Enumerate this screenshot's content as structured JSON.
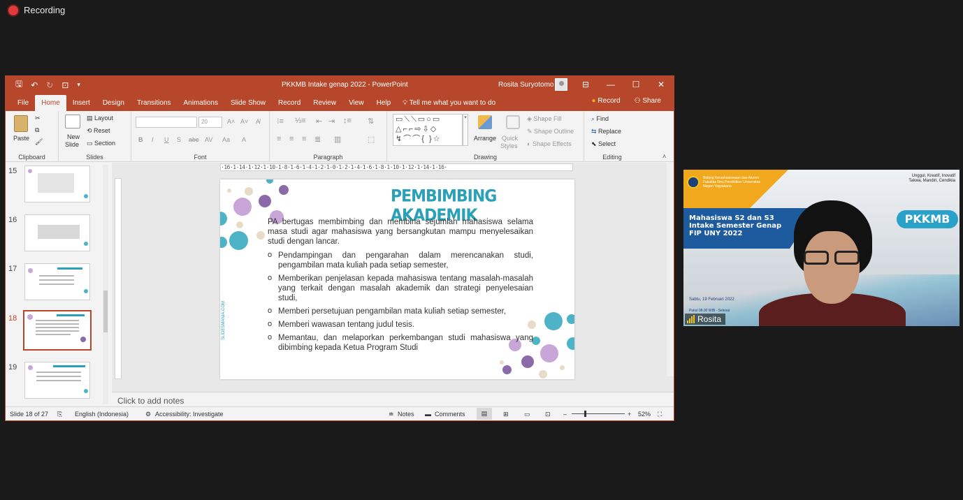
{
  "recording": {
    "label": "Recording"
  },
  "titlebar": {
    "doc_title": "PKKMB Intake genap 2022  -  PowerPoint",
    "user": "Rosita Suryotomo",
    "qat_icons": [
      "save-icon",
      "undo-icon",
      "redo-icon",
      "present-icon",
      "customize-icon"
    ],
    "window_buttons": [
      "ribbon-display-icon",
      "minimize-icon",
      "maximize-icon",
      "close-icon"
    ]
  },
  "menu": {
    "tabs": [
      "File",
      "Home",
      "Insert",
      "Design",
      "Transitions",
      "Animations",
      "Slide Show",
      "Record",
      "Review",
      "View",
      "Help"
    ],
    "active": "Home",
    "tell_me": "Tell me what you want to do",
    "record": "Record",
    "share": "Share"
  },
  "ribbon": {
    "clipboard": {
      "label": "Clipboard",
      "paste": "Paste"
    },
    "slides": {
      "label": "Slides",
      "new_slide": "New",
      "new_slide2": "Slide",
      "layout": "Layout",
      "reset": "Reset",
      "section": "Section"
    },
    "font": {
      "label": "Font",
      "font_name": "",
      "font_size": "20",
      "buttons": [
        "B",
        "I",
        "U",
        "S",
        "abc",
        "AV",
        "Aa",
        "A"
      ]
    },
    "paragraph": {
      "label": "Paragraph"
    },
    "drawing": {
      "label": "Drawing",
      "arrange": "Arrange",
      "quick_styles": "Quick",
      "quick_styles2": "Styles",
      "shape_fill": "Shape Fill",
      "shape_outline": "Shape Outline",
      "shape_effects": "Shape Effects"
    },
    "editing": {
      "label": "Editing",
      "find": "Find",
      "replace": "Replace",
      "select": "Select"
    }
  },
  "thumbnails": [
    {
      "num": "15",
      "selected": false
    },
    {
      "num": "16",
      "selected": false
    },
    {
      "num": "17",
      "selected": false
    },
    {
      "num": "18",
      "selected": true
    },
    {
      "num": "19",
      "selected": false
    }
  ],
  "ruler": {
    "marks": "·16·1·14·1·12·1·10·1·8·1·6·1·4·1·2·1·0·1·2·1·4·1·6·1·8·1·10·1·12·1·14·1·16·"
  },
  "slide": {
    "title": "PEMBIMBING AKADEMIK",
    "intro": "PA bertugas membimbing dan membina sejumlah mahasiswa selama masa studi agar mahasiswa yang bersangkutan mampu menyelesaikan studi dengan lancar.",
    "bullets": [
      "Pendampingan dan pengarahan dalam merencanakan studi, pengambilan mata kuliah pada setiap semester,",
      "Memberikan penjelasan kepada mahasiswa tentang masalah-masalah yang terkait dengan masalah akademik dan strategi penyelesaian studi,",
      "Memberi persetujuan pengambilan mata kuliah setiap semester,",
      "Memberi wawasan tentang judul tesis.",
      "Memantau, dan melaporkan perkembangan studi mahasiswa yang dibimbing kepada Ketua Program Studi"
    ],
    "vertical_url": "SLIDESMANIA.COM",
    "colors": {
      "title": "#2aa1b8",
      "teal": "#4fb3c8",
      "purple": "#8a6aa8",
      "lilac": "#c8a6d8",
      "beige": "#e8dcc8"
    }
  },
  "notes": {
    "placeholder": "Click to add notes"
  },
  "status": {
    "slide_of": "Slide 18 of 27",
    "language": "English (Indonesia)",
    "accessibility": "Accessibility: Investigate",
    "notes": "Notes",
    "comments": "Comments",
    "zoom": "52%",
    "zoom_minus": "–",
    "zoom_plus": "+"
  },
  "webcam": {
    "name": "Rosita",
    "banner_small": "Bidang Kemahasiswaan dan Alumni Fakultas Ilmu Pendidikan Universitas Negeri Yogyakarta",
    "tagline": "Unggul, Kreatif, Inovatif Takwa, Mandiri, Cendikia",
    "title1": "Mahasiswa S2 dan S3",
    "title2": "Intake Semester Genap",
    "title3": "FIP UNY 2022",
    "badge": "PKKMB",
    "date": "Sabtu, 19 Februari 2022",
    "time": "Pukul 08.00 WIB - Selesai"
  }
}
